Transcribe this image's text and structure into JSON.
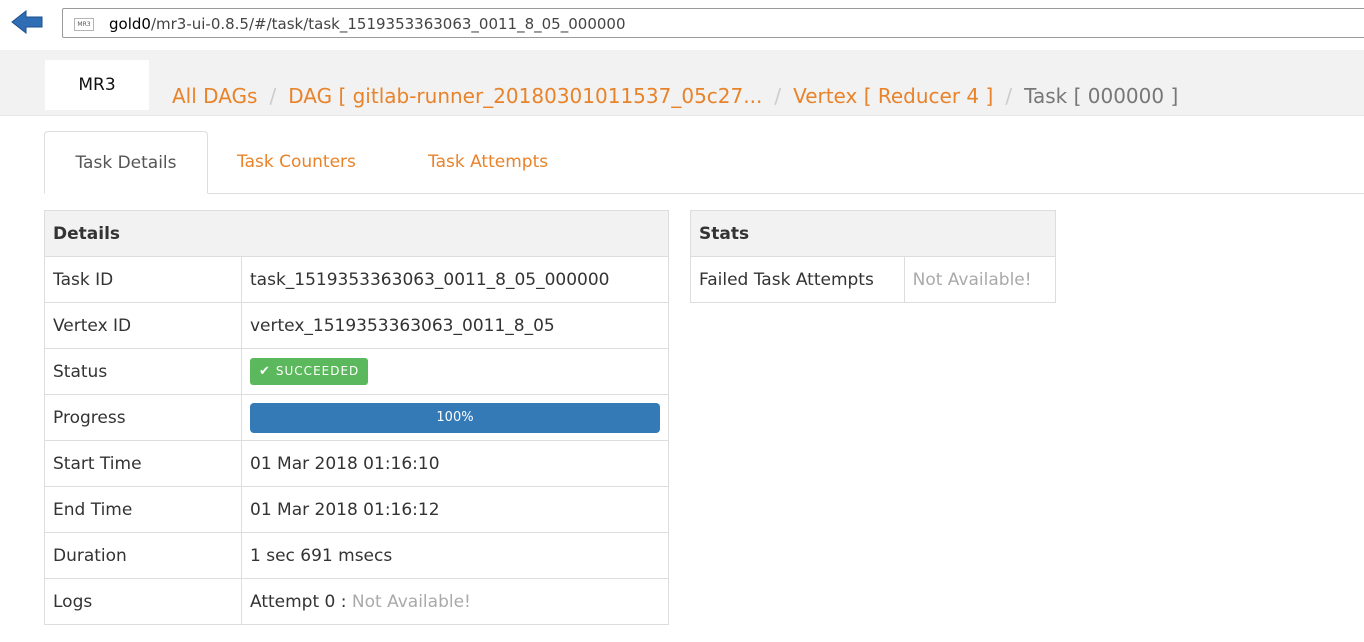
{
  "browser": {
    "url_host": "gold0",
    "url_path": "/mr3-ui-0.8.5/#/task/task_1519353363063_0011_8_05_000000",
    "favicon_label": "MR3"
  },
  "header": {
    "logo": "MR3",
    "breadcrumbs": [
      {
        "label": "All DAGs"
      },
      {
        "label": "DAG [ gitlab-runner_20180301011537_05c27..."
      },
      {
        "label": "Vertex [ Reducer 4 ]"
      },
      {
        "label": "Task [ 000000 ]"
      }
    ],
    "separator": "/"
  },
  "tabs": [
    {
      "label": "Task Details",
      "active": true
    },
    {
      "label": "Task Counters",
      "active": false
    },
    {
      "label": "Task Attempts",
      "active": false
    }
  ],
  "details": {
    "heading": "Details",
    "task_id_label": "Task ID",
    "task_id": "task_1519353363063_0011_8_05_000000",
    "vertex_id_label": "Vertex ID",
    "vertex_id": "vertex_1519353363063_0011_8_05",
    "status_label": "Status",
    "status": "SUCCEEDED",
    "progress_label": "Progress",
    "progress_percent": 100,
    "progress_text": "100%",
    "start_time_label": "Start Time",
    "start_time": "01 Mar 2018 01:16:10",
    "end_time_label": "End Time",
    "end_time": "01 Mar 2018 01:16:12",
    "duration_label": "Duration",
    "duration": "1 sec 691 msecs",
    "logs_label": "Logs",
    "logs_attempt": "Attempt 0 :",
    "logs_value": "Not Available!"
  },
  "stats": {
    "heading": "Stats",
    "failed_attempts_label": "Failed Task Attempts",
    "failed_attempts_value": "Not Available!"
  },
  "colors": {
    "link": "#e8832a",
    "success": "#5cb85c",
    "progress": "#337ab7",
    "back_arrow": "#2f6db5"
  },
  "icons": {
    "back": "back-arrow-icon",
    "status": "check-icon"
  }
}
